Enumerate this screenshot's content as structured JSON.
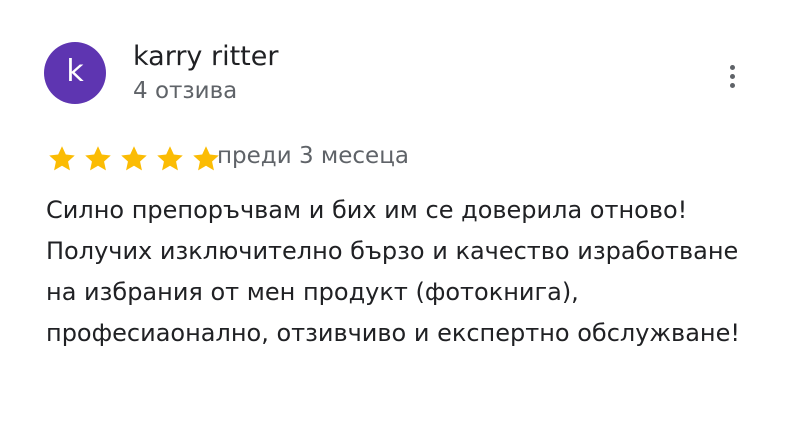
{
  "reviewer": {
    "avatar_letter": "k",
    "avatar_color": "#5e35b1",
    "name": "karry ritter",
    "review_count": "4 отзива"
  },
  "review": {
    "rating": 5,
    "max_rating": 5,
    "star_color": "#fbbc04",
    "date": "преди 3 месеца",
    "text": "Силно препоръчвам и бих им се доверила отново! Получих изключително бързо и качество изработване на избрания от мен продукт (фотокнига), професиаонално, отзивчиво и експертно обслужване!"
  },
  "icons": {
    "more": "more-vert-icon",
    "star": "star-icon"
  }
}
